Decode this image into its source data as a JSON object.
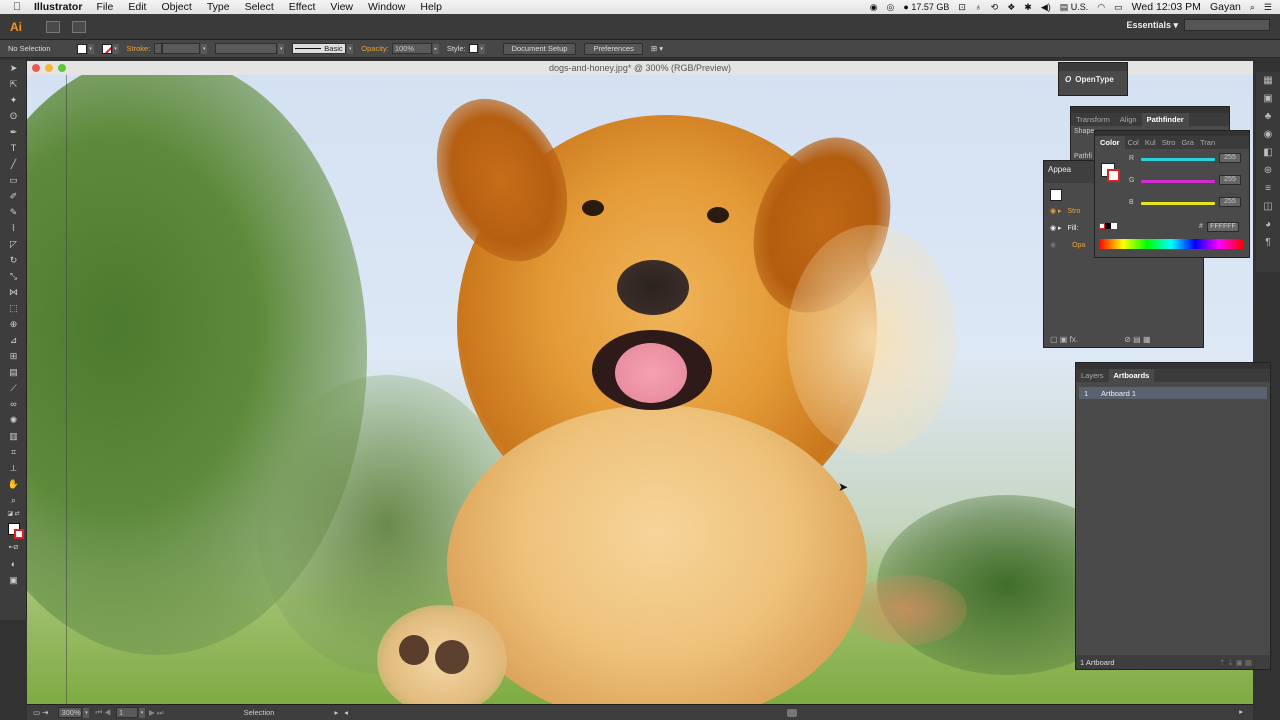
{
  "menubar": {
    "app_name": "Illustrator",
    "items": [
      "File",
      "Edit",
      "Object",
      "Type",
      "Select",
      "Effect",
      "View",
      "Window",
      "Help"
    ],
    "storage": "17.57 GB",
    "keyboard": "U.S.",
    "clock": "Wed 12:03 PM",
    "user": "Gayan"
  },
  "appbar": {
    "logo": "Ai",
    "workspace": "Essentials ▾"
  },
  "controlbar": {
    "selection": "No Selection",
    "stroke_label": "Stroke:",
    "brush": "Basic",
    "opacity_label": "Opacity:",
    "opacity_value": "100%",
    "style_label": "Style:",
    "document_setup": "Document Setup",
    "preferences": "Preferences"
  },
  "document": {
    "title": "dogs-and-honey.jpg* @ 300% (RGB/Preview)",
    "zoom": "300%",
    "page": "1",
    "status": "Selection"
  },
  "panels": {
    "opentype": "OpenType",
    "tf_tabs": [
      "Transform",
      "Align",
      "Pathfinder"
    ],
    "shape_label": "Shape",
    "pathf_label": "Pathfi",
    "color_tabs": [
      "Color",
      "Col",
      "Kul",
      "Stro",
      "Gra",
      "Tran"
    ],
    "color": {
      "r_label": "R",
      "g_label": "G",
      "b_label": "B",
      "r": "255",
      "g": "255",
      "b": "255",
      "hex_label": "#",
      "hex": "FFFFFF"
    },
    "appearance_title": "Appea",
    "appearance_rows": [
      "Stro",
      "Fill:",
      "Opa"
    ],
    "layers_tabs": [
      "Layers",
      "Artboards"
    ],
    "artboard_index": "1",
    "artboard_name": "Artboard 1",
    "artboard_count": "1 Artboard"
  },
  "colors": {
    "accent": "#f7941d",
    "r_slider": "#2ad3e0",
    "g_slider": "#d32ad3",
    "b_slider": "#e6e620"
  }
}
